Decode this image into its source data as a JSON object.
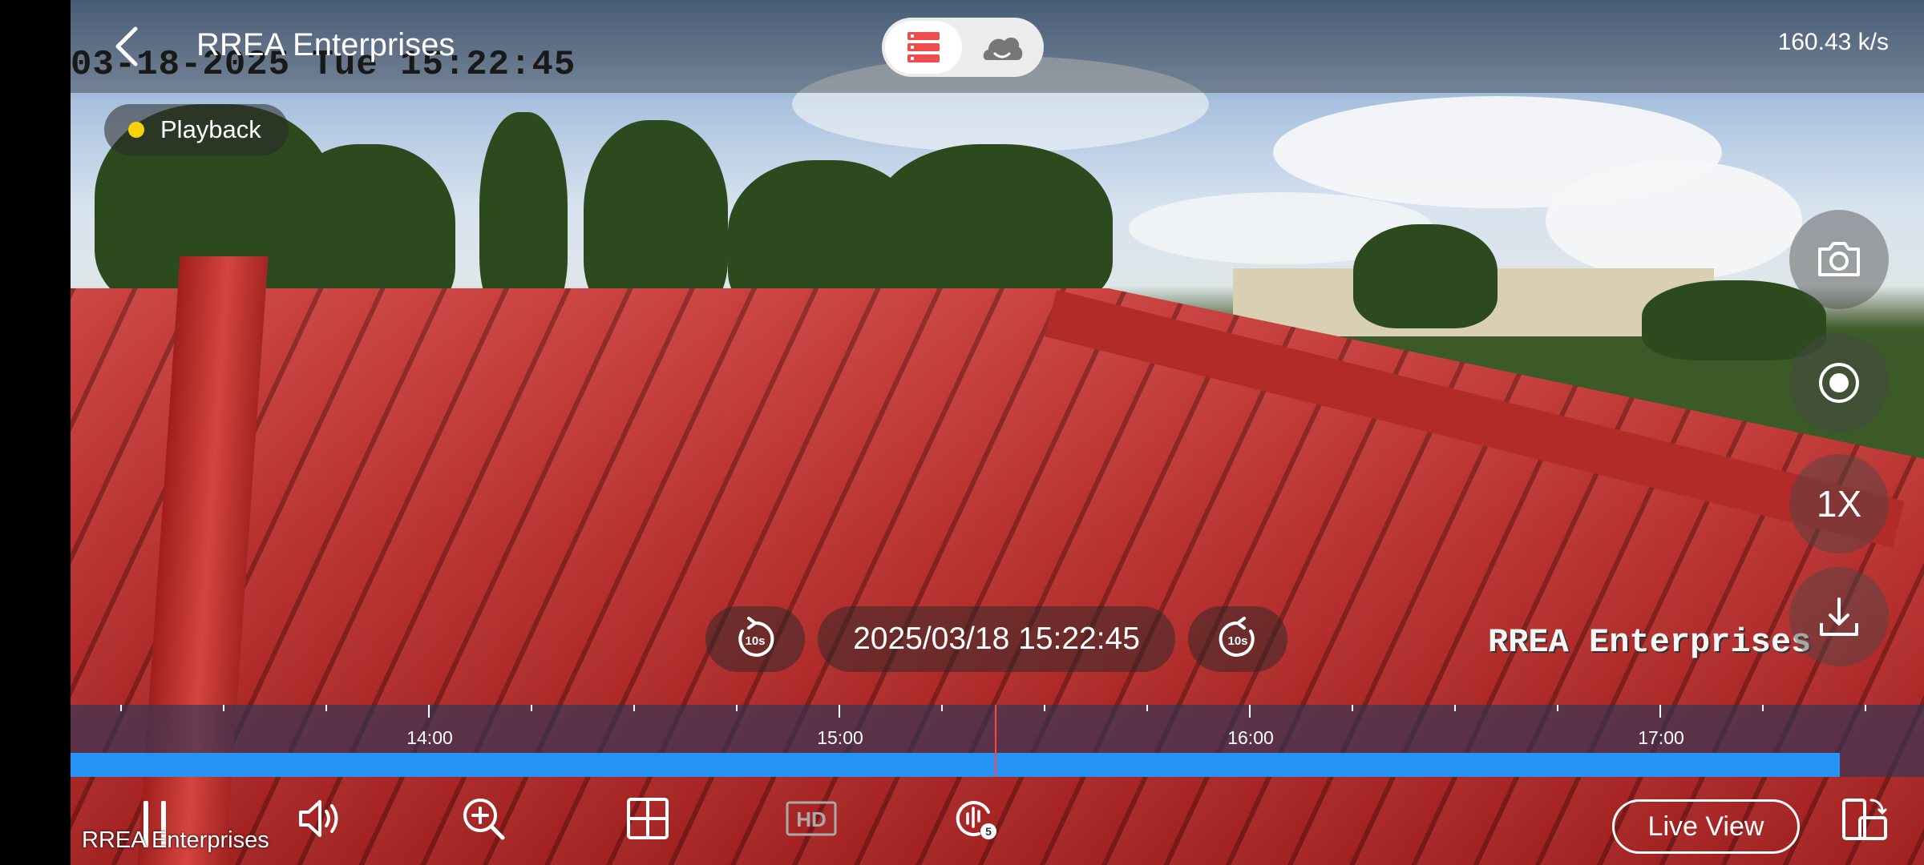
{
  "header": {
    "title": "RREA Enterprises",
    "storage_modes": [
      "local-storage-icon",
      "cloud-storage-icon"
    ],
    "active_mode": "local-storage-icon",
    "transfer_speed": "160.43 k/s"
  },
  "osd": {
    "timestamp": "03-18-2025 Tue 15:22:45",
    "watermark": "RREA Enterprises"
  },
  "status": {
    "badge_label": "Playback",
    "badge_color": "#f5d20a"
  },
  "side_controls": {
    "snapshot": "camera-icon",
    "record": "record-icon",
    "speed_label": "1X",
    "download": "download-icon"
  },
  "seek": {
    "rewind_label": "10s",
    "forward_label": "10s",
    "current_time": "2025/03/18 15:22:45"
  },
  "timeline": {
    "labels": [
      "14:00",
      "15:00",
      "16:00",
      "17:00"
    ],
    "recording_color": "#2793f4",
    "cursor_color": "#ff4444"
  },
  "bottom": {
    "device_name": "RREA Enterprises",
    "live_view_label": "Live View",
    "quality_label": "HD",
    "speaker_level": "5"
  }
}
